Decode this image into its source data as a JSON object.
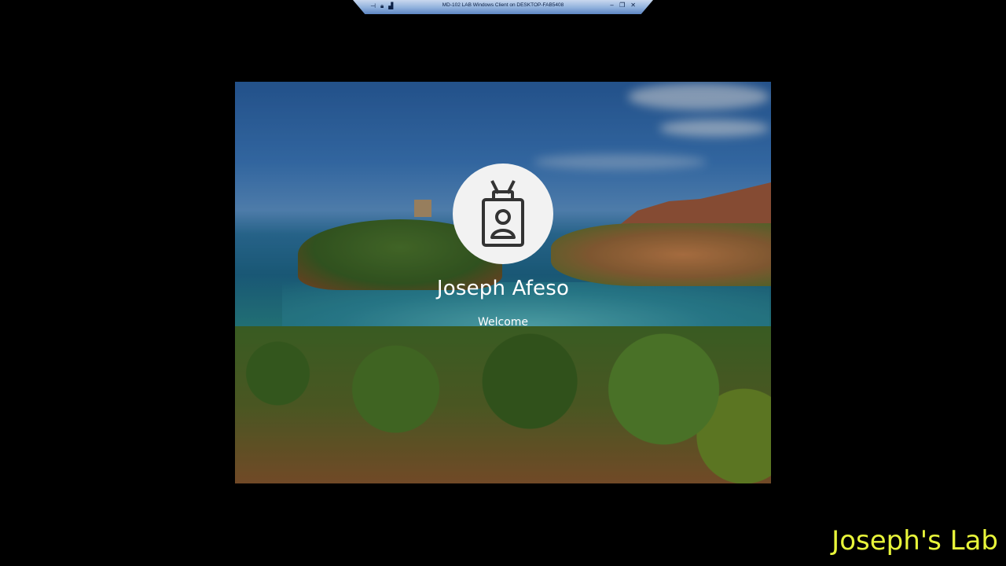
{
  "rdp_bar": {
    "title": "MD-102 LAB Windows Client on DESKTOP-FAB5408",
    "left_icons": [
      "pin-icon",
      "lock-icon",
      "signal-icon"
    ],
    "right_icons": [
      "minimize-icon",
      "restore-icon",
      "close-icon"
    ]
  },
  "lock_screen": {
    "user_name": "Joseph Afeso",
    "status": "Welcome",
    "avatar_icon": "user-badge-icon"
  },
  "watermark": {
    "text": "Joseph's Lab",
    "color": "#e8f53a"
  }
}
